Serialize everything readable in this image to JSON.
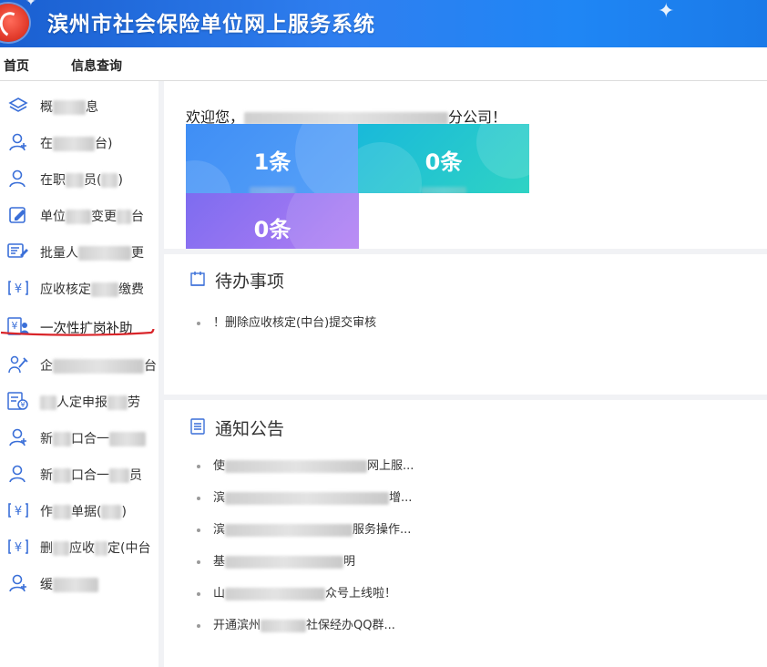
{
  "header": {
    "title": "滨州市社会保险单位网上服务系统"
  },
  "tabs": [
    {
      "label": "首页"
    },
    {
      "label": "信息查询"
    }
  ],
  "sidebar": {
    "items": [
      {
        "pre": "概",
        "post": "息",
        "icon": "layers-icon"
      },
      {
        "pre": "在",
        "post": "台)",
        "icon": "user-add-icon"
      },
      {
        "pre": "在职",
        "post": "员(",
        "icon": "user-icon"
      },
      {
        "pre": "单位",
        "post": "变更",
        "icon": "edit-form-icon"
      },
      {
        "pre": "批量人",
        "post": "更",
        "icon": "batch-edit-icon"
      },
      {
        "pre": "应收核定",
        "post": "缴费",
        "icon": "yen-card-icon"
      },
      {
        "pre": "一次性扩岗补助",
        "post": "",
        "icon": "yen-user-icon"
      },
      {
        "pre": "企",
        "post": "台",
        "icon": "worker-icon"
      },
      {
        "pre": "",
        "post": "人定申报",
        "icon": "yen-doc-icon"
      },
      {
        "pre": "新",
        "post": "口合一",
        "icon": "user-add-icon"
      },
      {
        "pre": "新",
        "post": "口合一",
        "icon": "user-icon"
      },
      {
        "pre": "作",
        "post": "单据(",
        "icon": "yen-card-icon"
      },
      {
        "pre": "删",
        "post": "应收",
        "icon": "yen-card-icon"
      },
      {
        "pre": "缓",
        "post": "",
        "icon": "user-add-icon"
      }
    ]
  },
  "main": {
    "welcome_prefix": "欢迎您，",
    "welcome_suffix": "分公司！",
    "cards": [
      {
        "count": "1条",
        "color": "#4a95f6"
      },
      {
        "count": "0条",
        "color": "#22c4cf"
      },
      {
        "count": "0条",
        "color": "#9a75f2"
      }
    ],
    "todo": {
      "title": "待办事项",
      "items": [
        "！删除应收核定(中台)提交审核"
      ]
    },
    "notice": {
      "title": "通知公告",
      "items": [
        {
          "pre": "使",
          "post": "网上服..."
        },
        {
          "pre": "滨",
          "post": "增..."
        },
        {
          "pre": "滨",
          "post": "服务操作..."
        },
        {
          "pre": "基",
          "post": "明"
        },
        {
          "pre": "山",
          "post": "众号上线啦！"
        },
        {
          "pre": "开通滨州",
          "post": "社保经办QQ群..."
        }
      ]
    }
  },
  "colors": {
    "accent": "#1a73e8",
    "header": "#2f7ff0"
  }
}
